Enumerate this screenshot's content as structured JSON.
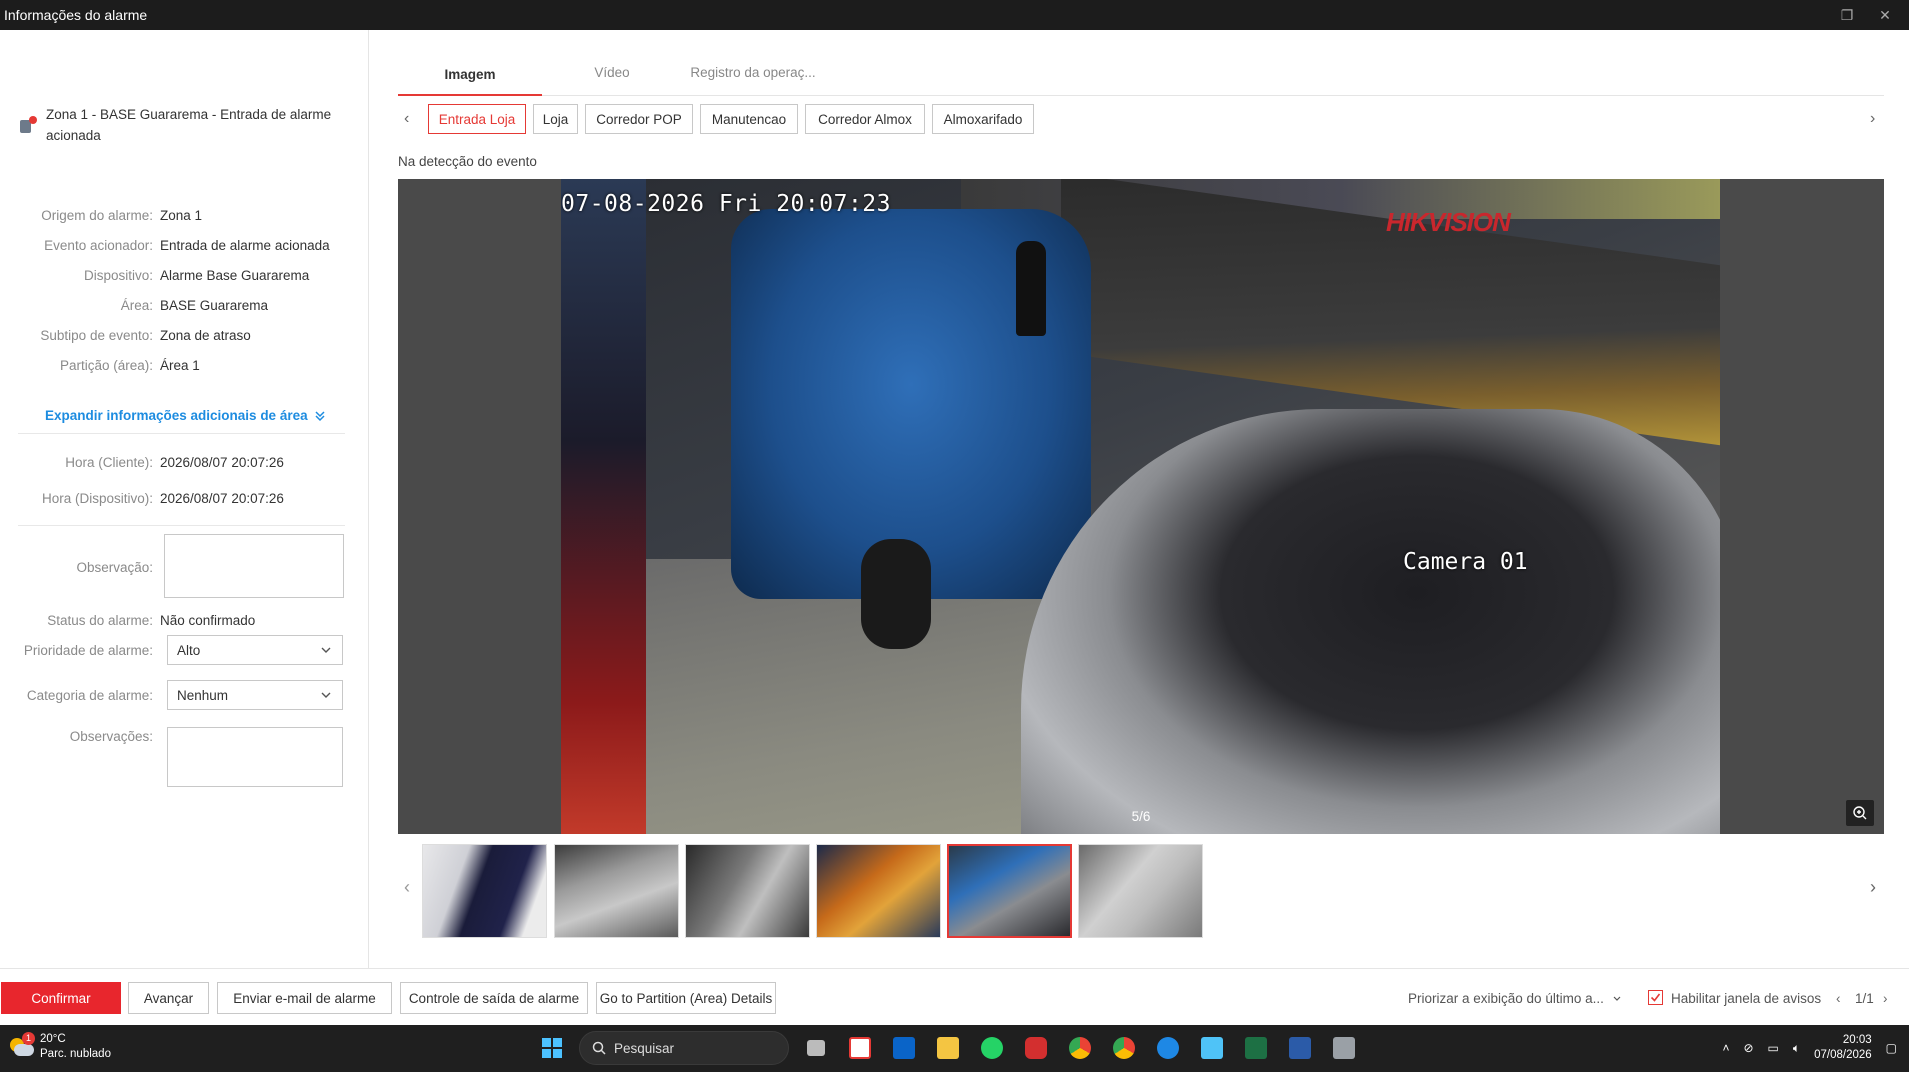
{
  "window": {
    "title": "Informações do alarme"
  },
  "alarm": {
    "header": "Zona 1 - BASE Guararema - Entrada de alarme acionada"
  },
  "details": [
    {
      "label": "Origem do alarme:",
      "value": "Zona 1"
    },
    {
      "label": "Evento acionador:",
      "value": "Entrada de alarme acionada"
    },
    {
      "label": "Dispositivo:",
      "value": "Alarme Base Guararema"
    },
    {
      "label": "Área:",
      "value": "BASE Guararema"
    },
    {
      "label": "Subtipo de evento:",
      "value": "Zona de atraso"
    },
    {
      "label": "Partição (área):",
      "value": "Área 1"
    }
  ],
  "expand_label": "Expandir informações adicionais de área",
  "times": [
    {
      "label": "Hora (Cliente):",
      "value": "2026/08/07 20:07:26"
    },
    {
      "label": "Hora (Dispositivo):",
      "value": "2026/08/07 20:07:26"
    }
  ],
  "form": {
    "observacao_label": "Observação:",
    "status_label": "Status do alarme:",
    "status_value": "Não confirmado",
    "prioridade_label": "Prioridade de alarme:",
    "prioridade_value": "Alto",
    "categoria_label": "Categoria de alarme:",
    "categoria_value": "Nenhum",
    "observacoes_label": "Observações:"
  },
  "tabs": [
    "Imagem",
    "Vídeo",
    "Registro da operaç..."
  ],
  "cameras": [
    "Entrada Loja",
    "Loja",
    "Corredor POP",
    "Manutencao",
    "Corredor Almox",
    "Almoxarifado"
  ],
  "event_label": "Na detecção do evento",
  "viewer": {
    "osd_time": "07-08-2026 Fri 20:07:23",
    "osd_camera": "Camera 01",
    "osd_brand": "HIKVISION",
    "counter": "5/6"
  },
  "footer": {
    "confirm": "Confirmar",
    "next": "Avançar",
    "email": "Enviar e-mail de alarme",
    "output": "Controle de saída de alarme",
    "partition": "Go to Partition (Area) Details",
    "priority_display": "Priorizar a exibição do último a...",
    "enable_popup": "Habilitar janela de avisos",
    "pages": "1/1"
  },
  "taskbar": {
    "temp": "20°C",
    "weather": "Parc. nublado",
    "weather_badge": "1",
    "search": "Pesquisar",
    "time": "20:03",
    "date": "07/08/2026"
  },
  "colors": {
    "accent": "#e53935",
    "link": "#1d8ce0",
    "titlebar": "#1c1c1c",
    "taskbar": "#1f1f1f"
  }
}
